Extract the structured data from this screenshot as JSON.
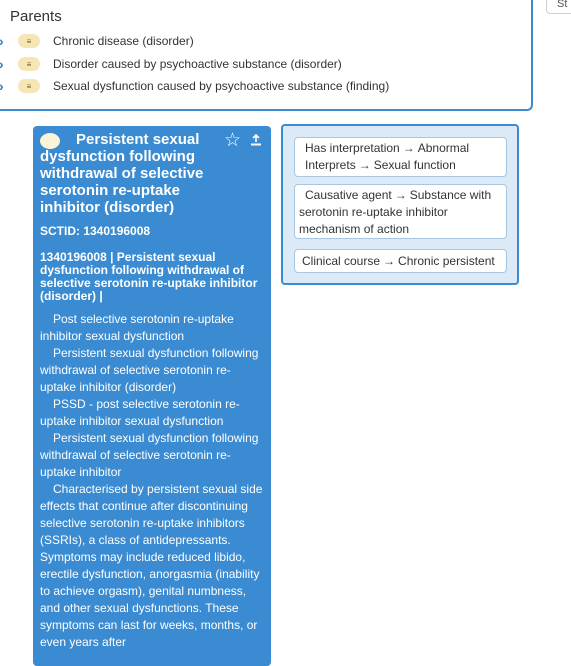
{
  "parents": {
    "title": "Parents",
    "items": [
      {
        "label": "Chronic disease (disorder)"
      },
      {
        "label": "Disorder caused by psychoactive substance (disorder)"
      },
      {
        "label": "Sexual dysfunction caused by psychoactive substance (finding)"
      }
    ],
    "chevron_glyph": "›",
    "pill_glyph": "≡"
  },
  "top_right_button": {
    "label": "St"
  },
  "concept": {
    "title": "Persistent sexual dysfunction following withdrawal of selective serotonin re-uptake inhibitor (disorder)",
    "sctid_text": "SCTID: 1340196008",
    "fsn_text": "1340196008 | Persistent sexual dysfunction following withdrawal of selective serotonin re-uptake inhibitor (disorder) |",
    "descriptions": [
      "Post selective serotonin re-uptake inhibitor sexual dysfunction",
      "Persistent sexual dysfunction following withdrawal of selective serotonin re-uptake inhibitor (disorder)",
      "PSSD - post selective serotonin re-uptake inhibitor sexual dysfunction",
      "Persistent sexual dysfunction following withdrawal of selective serotonin re-uptake inhibitor",
      "Characterised by persistent sexual side effects that continue after discontinuing selective serotonin re-uptake inhibitors (SSRIs), a class of antidepressants. Symptoms may include reduced libido, erectile dysfunction, anorgasmia (inability to achieve orgasm), genital numbness, and other sexual dysfunctions. These symptoms can last for weeks, months, or even years after"
    ],
    "star_glyph": "☆",
    "accent_color": "#3a8bd1"
  },
  "relationships": [
    {
      "type": "Has interpretation",
      "target": "Abnormal",
      "type2": "Interprets",
      "target2": "Sexual function"
    },
    {
      "type": "Causative agent",
      "target": "Substance with serotonin re-uptake inhibitor mechanism of action"
    },
    {
      "type": "Clinical course",
      "target": "Chronic persistent"
    }
  ],
  "arrow_glyph": "→"
}
